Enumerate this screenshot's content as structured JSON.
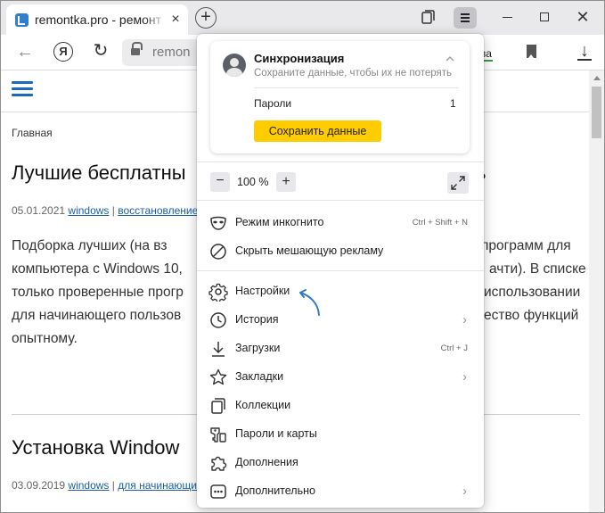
{
  "browser": {
    "tab_title": "remontka.pro - ремонт",
    "tab_close": "×",
    "new_tab": "+",
    "address_text": "remon",
    "address_right_fragment": "ва",
    "window_close": "✕"
  },
  "page": {
    "breadcrumb": "Главная",
    "articles": [
      {
        "title": "Лучшие бесплатны",
        "title_tail": "ь",
        "date": "05.01.2021",
        "tag1": "windows",
        "separator": "|",
        "tag2": "восстановление",
        "excerpt_left": [
          "Подборка  лучших  (на  вз",
          "компьютера с Windows 10,",
          "только  проверенные  прогр",
          "для  начинающего  пользов",
          "опытному."
        ],
        "excerpt_right": [
          "программ  для",
          "ачти).  В  списке",
          "использовании",
          "ество  функций",
          ""
        ]
      },
      {
        "title": "Установка Window",
        "date": "03.09.2019",
        "tag1": "windows",
        "separator": "|",
        "tag2": "для начинающи"
      }
    ]
  },
  "menu": {
    "sync": {
      "title": "Синхронизация",
      "subtitle": "Сохраните данные, чтобы их не потерять",
      "passwords_label": "Пароли",
      "passwords_count": "1",
      "save_button": "Сохранить данные"
    },
    "zoom": {
      "minus": "−",
      "level": "100 %",
      "plus": "+"
    },
    "items": [
      {
        "label": "Режим инкогнито",
        "shortcut": "Ctrl + Shift + N",
        "icon": "incognito-mask-icon"
      },
      {
        "label": "Скрыть мешающую рекламу",
        "shortcut": "",
        "icon": "block-ads-icon"
      },
      {
        "label": "Настройки",
        "shortcut": "",
        "icon": "settings-gear-icon"
      },
      {
        "label": "История",
        "shortcut": "",
        "icon": "history-clock-icon",
        "submenu": true
      },
      {
        "label": "Загрузки",
        "shortcut": "Ctrl + J",
        "icon": "download-arrow-icon"
      },
      {
        "label": "Закладки",
        "shortcut": "",
        "icon": "bookmark-star-icon",
        "submenu": true
      },
      {
        "label": "Коллекции",
        "shortcut": "",
        "icon": "collections-icon"
      },
      {
        "label": "Пароли и карты",
        "shortcut": "",
        "icon": "key-icon"
      },
      {
        "label": "Дополнения",
        "shortcut": "",
        "icon": "puzzle-icon"
      },
      {
        "label": "Дополнительно",
        "shortcut": "",
        "icon": "more-dots-icon",
        "submenu": true
      }
    ]
  },
  "colors": {
    "accent_yellow": "#ffcc00",
    "link_blue": "#1a5fa8",
    "annotation_arrow": "#2e7bbf"
  }
}
